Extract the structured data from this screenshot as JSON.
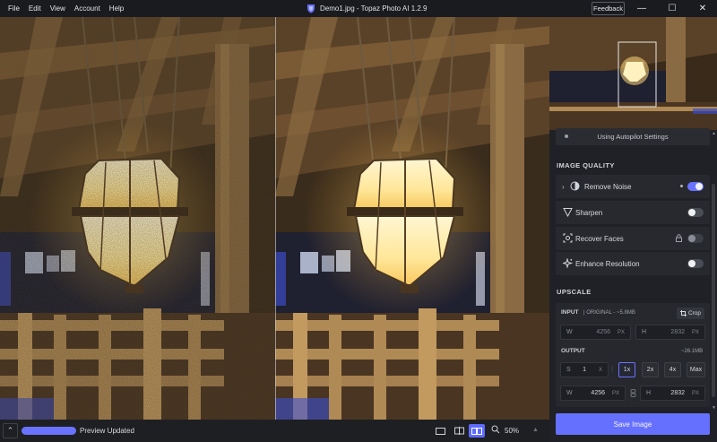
{
  "menu": [
    "File",
    "Edit",
    "View",
    "Account",
    "Help"
  ],
  "app_title": "Demo1.jpg - Topaz Photo AI 1.2.9",
  "feedback_label": "Feedback",
  "window_controls": {
    "minimize": "—",
    "maximize": "☐",
    "close": "✕"
  },
  "autopilot_text": "Using Autopilot Settings",
  "image_quality_title": "IMAGE QUALITY",
  "features": [
    {
      "label": "Remove Noise",
      "icon": "noise-icon",
      "enabled": true
    },
    {
      "label": "Sharpen",
      "icon": "sharpen-icon",
      "enabled": false
    },
    {
      "label": "Recover Faces",
      "icon": "face-icon",
      "enabled": false
    },
    {
      "label": "Enhance Resolution",
      "icon": "enhance-icon",
      "enabled": false
    }
  ],
  "upscale_title": "UPSCALE",
  "input": {
    "label": "INPUT",
    "meta": "| ORIGINAL - ~5.8MB",
    "crop_label": "Crop",
    "w_prefix": "W",
    "w_value": "4256",
    "w_unit": "PX",
    "h_prefix": "H",
    "h_value": "2832",
    "h_unit": "PX"
  },
  "output": {
    "label": "OUTPUT",
    "size": "~26.1MB",
    "s_prefix": "S",
    "s_value": "1",
    "s_unit": "X",
    "scale_options": [
      "1x",
      "2x",
      "4x",
      "Max"
    ],
    "selected_scale": "1x",
    "w_prefix": "W",
    "w_value": "4256",
    "w_unit": "PX",
    "h_prefix": "H",
    "h_value": "2832",
    "h_unit": "PX"
  },
  "save_label": "Save Image",
  "status": {
    "preview_text": "Preview Updated",
    "progress": 1.0,
    "zoom": "50%"
  },
  "colors": {
    "accent": "#6a73ff",
    "panel": "#202126"
  }
}
